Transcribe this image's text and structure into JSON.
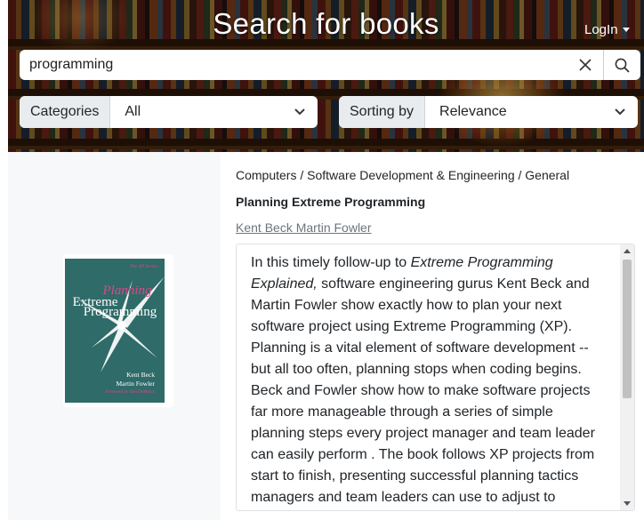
{
  "header": {
    "title": "Search for books",
    "login_label": "LogIn"
  },
  "search": {
    "value": "programming",
    "placeholder": ""
  },
  "filters": {
    "categories_label": "Categories",
    "categories_value": "All",
    "sorting_label": "Sorting by",
    "sorting_value": "Relevance"
  },
  "result": {
    "breadcrumb": "Computers / Software Development & Engineering / General",
    "title": "Planning Extreme Programming",
    "authors": "Kent Beck Martin Fowler",
    "description": {
      "intro": "In this timely follow-up to ",
      "italic_title": "Extreme Programming Explained,",
      "body": " software engineering gurus Kent Beck and Martin Fowler show exactly how to plan your next software project using Extreme Programming (XP). Planning is a vital element of software development -- but all too often, planning stops when coding begins. Beck and Fowler show how to make software projects far more manageable through a series of simple planning steps every project manager and team leader can easily perform . The book follows XP projects from start to finish, presenting successful planning tactics managers and team leaders can use to adjust to changing conditions."
    },
    "cover": {
      "series": "The XP Series",
      "word1": "Planning",
      "word2": "Extreme",
      "word3": "Programming",
      "author1": "Kent Beck",
      "author2": "Martin Fowler",
      "foreword": "Foreword by Tom DeMarco",
      "bg_color": "#2f6b68",
      "accent_color": "#e0458a"
    }
  }
}
